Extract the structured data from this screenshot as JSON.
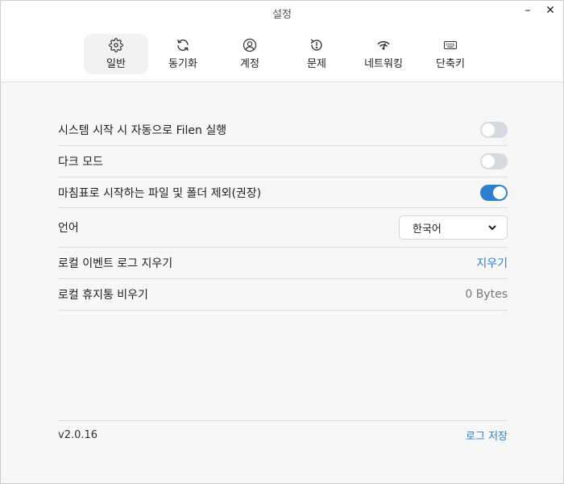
{
  "window": {
    "title": "설정"
  },
  "tabs": [
    {
      "label": "일반",
      "icon": "gear-icon",
      "active": true
    },
    {
      "label": "동기화",
      "icon": "sync-icon",
      "active": false
    },
    {
      "label": "계정",
      "icon": "account-icon",
      "active": false
    },
    {
      "label": "문제",
      "icon": "issues-icon",
      "active": false
    },
    {
      "label": "네트워킹",
      "icon": "network-icon",
      "active": false
    },
    {
      "label": "단축키",
      "icon": "keyboard-icon",
      "active": false
    }
  ],
  "settings": {
    "launch_at_startup": {
      "label": "시스템 시작 시 자동으로 Filen 실행",
      "enabled": false
    },
    "dark_mode": {
      "label": "다크 모드",
      "enabled": false
    },
    "exclude_dot": {
      "label": "마침표로 시작하는 파일 및 폴더 제외(권장)",
      "enabled": true
    },
    "language": {
      "label": "언어",
      "value": "한국어"
    },
    "clear_logs": {
      "label": "로컬 이벤트 로그 지우기",
      "action": "지우기"
    },
    "empty_trash": {
      "label": "로컬 휴지통 비우기",
      "size": "0 Bytes"
    }
  },
  "footer": {
    "version": "v2.0.16",
    "save_logs": "로그 저장"
  },
  "colors": {
    "accent": "#2f7fd1",
    "toggle_off": "#d6d9de"
  }
}
